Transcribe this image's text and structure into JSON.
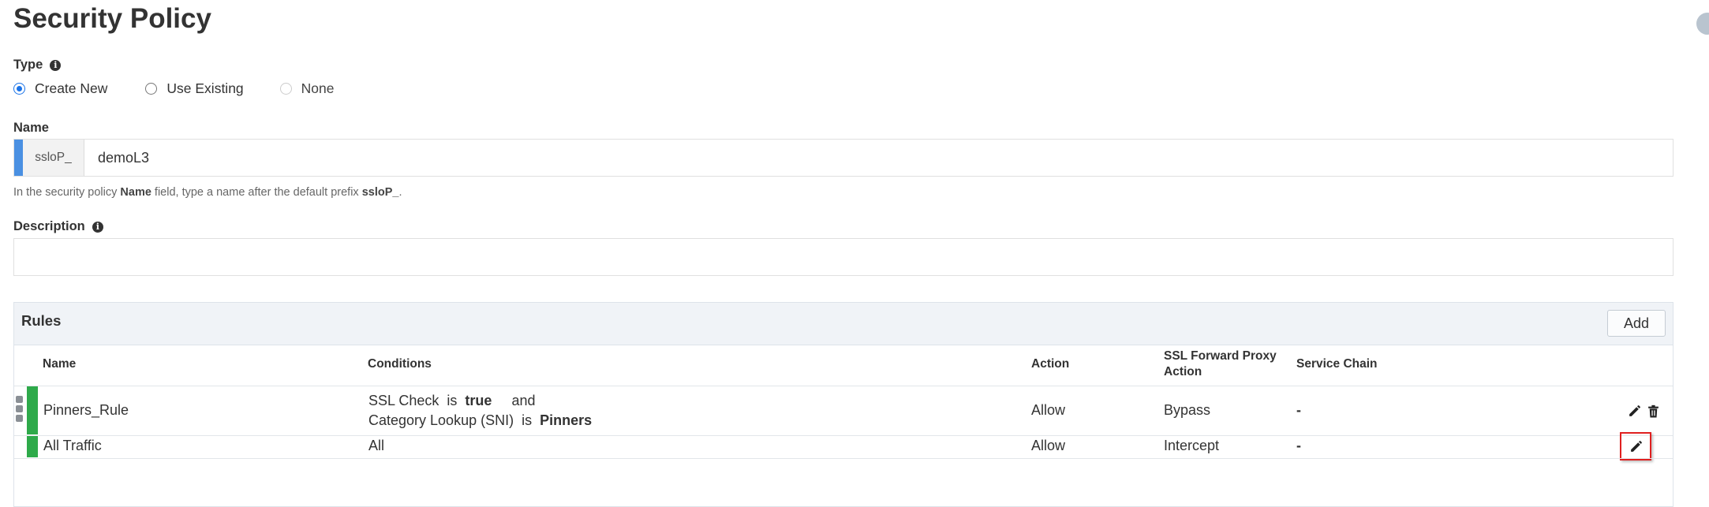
{
  "page": {
    "title": "Security Policy"
  },
  "type_field": {
    "label": "Type",
    "options": [
      {
        "label": "Create New",
        "checked": true
      },
      {
        "label": "Use Existing",
        "checked": false
      },
      {
        "label": "None",
        "checked": false,
        "disabled": true
      }
    ]
  },
  "name_field": {
    "label": "Name",
    "prefix": "ssloP_",
    "value": "demoL3",
    "help_before": "In the security policy ",
    "help_bold1": "Name",
    "help_middle": " field, type a name after the default prefix ",
    "help_bold2": "ssloP_",
    "help_after": "."
  },
  "description_field": {
    "label": "Description",
    "value": ""
  },
  "rules": {
    "title": "Rules",
    "add_label": "Add",
    "columns": {
      "name": "Name",
      "conditions": "Conditions",
      "action": "Action",
      "ssl_forward_proxy_action_1": "SSL Forward Proxy",
      "ssl_forward_proxy_action_2": "Action",
      "service_chain": "Service Chain"
    },
    "rows": [
      {
        "name": "Pinners_Rule",
        "cond1_label": "SSL Check",
        "cond1_op": "is",
        "cond1_value": "true",
        "cond_joiner": "and",
        "cond2_label": "Category Lookup (SNI)",
        "cond2_op": "is",
        "cond2_value": "Pinners",
        "action": "Allow",
        "ssl_action": "Bypass",
        "service_chain": "-",
        "status_color": "#2eaa4a"
      },
      {
        "name": "All Traffic",
        "conditions": "All",
        "action": "Allow",
        "ssl_action": "Intercept",
        "service_chain": "-",
        "status_color": "#2eaa4a"
      }
    ]
  },
  "icons": {
    "info": "info-icon",
    "edit": "pencil-icon",
    "delete": "trash-icon",
    "drag": "drag-handle-icon"
  }
}
